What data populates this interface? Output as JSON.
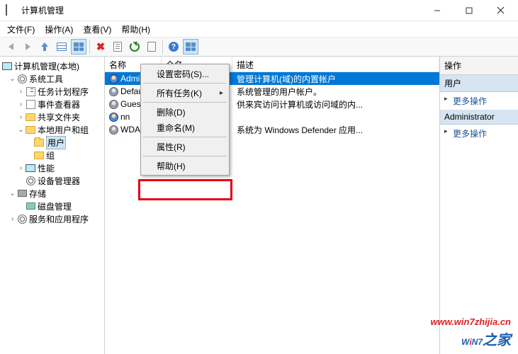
{
  "window": {
    "title": "计算机管理"
  },
  "menu": {
    "file": "文件(F)",
    "action": "操作(A)",
    "view": "查看(V)",
    "help": "帮助(H)"
  },
  "tree": {
    "root": "计算机管理(本地)",
    "systools": "系统工具",
    "scheduler": "任务计划程序",
    "eventviewer": "事件查看器",
    "shared": "共享文件夹",
    "localusers": "本地用户和组",
    "users": "用户",
    "groups": "组",
    "perf": "性能",
    "devmgr": "设备管理器",
    "storage": "存储",
    "diskmgr": "磁盘管理",
    "services": "服务和应用程序"
  },
  "list": {
    "headers": {
      "name": "名称",
      "fullname": "全名",
      "desc": "描述"
    },
    "rows": [
      {
        "name": "Administrator",
        "fullname": "",
        "desc": "管理计算机(域)的内置帐户"
      },
      {
        "name": "DefaultAccount",
        "fullname": "",
        "desc": "系统管理的用户帐户。"
      },
      {
        "name": "Guest",
        "fullname": "",
        "desc": "供来宾访问计算机或访问域的内..."
      },
      {
        "name": "nn",
        "fullname": "",
        "desc": ""
      },
      {
        "name": "WDAGUtilityAccount",
        "fullname": "",
        "desc": "系统为 Windows Defender 应用..."
      }
    ]
  },
  "context": {
    "setpwd": "设置密码(S)...",
    "alltasks": "所有任务(K)",
    "delete": "删除(D)",
    "rename": "重命名(M)",
    "properties": "属性(R)",
    "help": "帮助(H)"
  },
  "actions": {
    "header": "操作",
    "sec1": "用户",
    "more": "更多操作",
    "sec2": "Administrator"
  },
  "watermark": {
    "url": "www.win7zhijia.cn",
    "logo_text": "WiN7之家"
  }
}
